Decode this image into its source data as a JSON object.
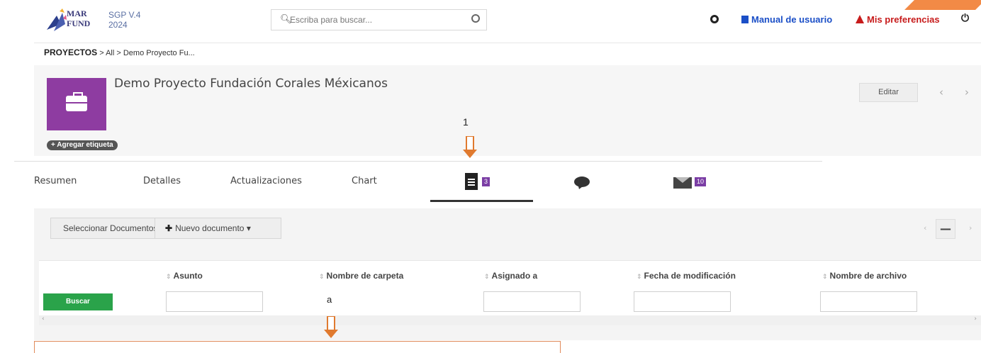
{
  "header": {
    "logo_line1": "MAR",
    "logo_line2": "FUND",
    "version": "SGP V.4",
    "year": "2024",
    "search_placeholder": "Escriba para buscar...",
    "manual_link": "Manual de usuario",
    "prefs_link": "Mis preferencias",
    "accent_color": "#f28a46"
  },
  "breadcrumb": {
    "root": "PROYECTOS",
    "sep": " > ",
    "all": "All",
    "current": "Demo Proyecto Fu..."
  },
  "project": {
    "title": "Demo Proyecto Fundación Corales Méxicanos",
    "tag_button": "+ Agregar etiqueta",
    "edit_button": "Editar",
    "icon_color": "#8e3ca1"
  },
  "annotations": {
    "step": "1",
    "sub": "a",
    "arrow_color": "#e07a2f"
  },
  "tabs": {
    "items": [
      {
        "label": "Resumen"
      },
      {
        "label": "Detalles"
      },
      {
        "label": "Actualizaciones"
      },
      {
        "label": "Chart"
      }
    ],
    "documents_count": "3",
    "messages_count": "10"
  },
  "documents": {
    "select_button": "Seleccionar Documentos",
    "new_button": "Nuevo documento",
    "pager_mid": "—",
    "columns": [
      "Asunto",
      "Nombre de carpeta",
      "Asignado a",
      "Fecha de modificación",
      "Nombre de archivo"
    ],
    "search_button": "Buscar"
  }
}
